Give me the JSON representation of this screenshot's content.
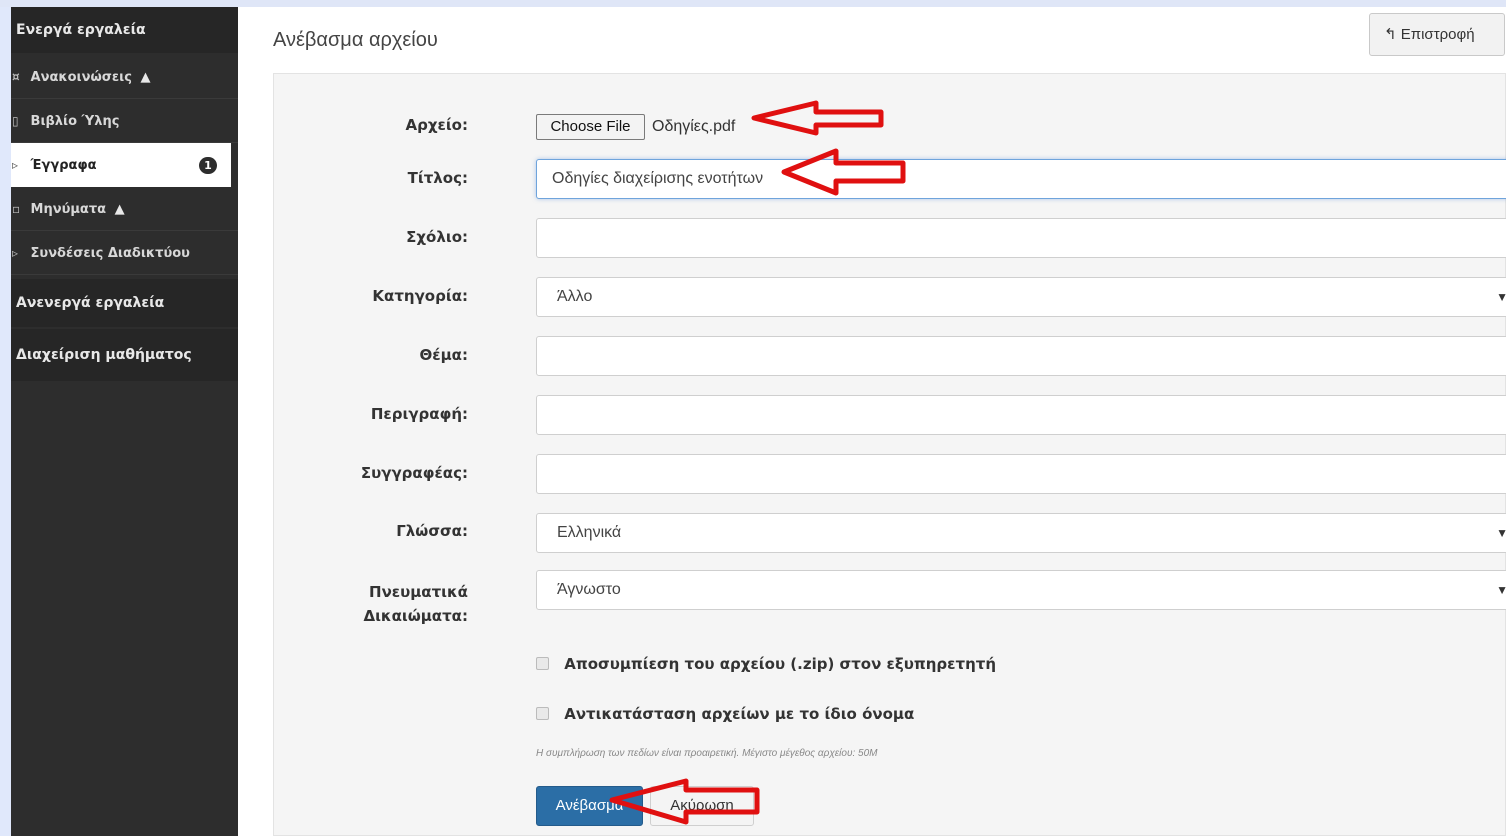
{
  "sidebar": {
    "sections": [
      "Ενεργά εργαλεία",
      "Ανενεργά εργαλεία",
      "Διαχείριση μαθήματος"
    ],
    "items": [
      {
        "label": "Ανακοινώσεις",
        "icon": "bullhorn-icon",
        "warning": "▲"
      },
      {
        "label": "Βιβλίο Ύλης",
        "icon": "book-icon"
      },
      {
        "label": "Έγγραφα",
        "icon": "folder-icon",
        "badge": "1"
      },
      {
        "label": "Μηνύματα",
        "icon": "envelope-icon",
        "warning": "▲"
      },
      {
        "label": "Συνδέσεις Διαδικτύου",
        "icon": "link-icon"
      }
    ]
  },
  "header": {
    "title": "Ανέβασμα αρχείου",
    "back_label": "Επιστροφή"
  },
  "form": {
    "file": {
      "label": "Αρχείο:",
      "button": "Choose File",
      "filename": "Οδηγίες.pdf"
    },
    "title": {
      "label": "Τίτλος:",
      "value": "Οδηγίες διαχείρισης ενοτήτων"
    },
    "comment": {
      "label": "Σχόλιο:",
      "value": ""
    },
    "category": {
      "label": "Κατηγορία:",
      "value": "Άλλο"
    },
    "subject": {
      "label": "Θέμα:",
      "value": ""
    },
    "description": {
      "label": "Περιγραφή:",
      "value": ""
    },
    "author": {
      "label": "Συγγραφέας:",
      "value": ""
    },
    "language": {
      "label": "Γλώσσα:",
      "value": "Ελληνικά"
    },
    "copyright": {
      "label_line1": "Πνευματικά",
      "label_line2": "Δικαιώματα:",
      "value": "Άγνωστο"
    },
    "unzip": "Αποσυμπίεση του αρχείου (.zip) στον εξυπηρετητή",
    "overwrite": "Αντικατάσταση αρχείων με το ίδιο όνομα",
    "hint": "Η συμπλήρωση των πεδίων είναι προαιρετική. Μέγιστο μέγεθος αρχείου: 50M",
    "upload_label": "Ανέβασμα",
    "cancel_label": "Ακύρωση"
  },
  "colors": {
    "arrow": "#e01010",
    "primary": "#2b6ea6",
    "sidebar": "#2d2d2d"
  }
}
